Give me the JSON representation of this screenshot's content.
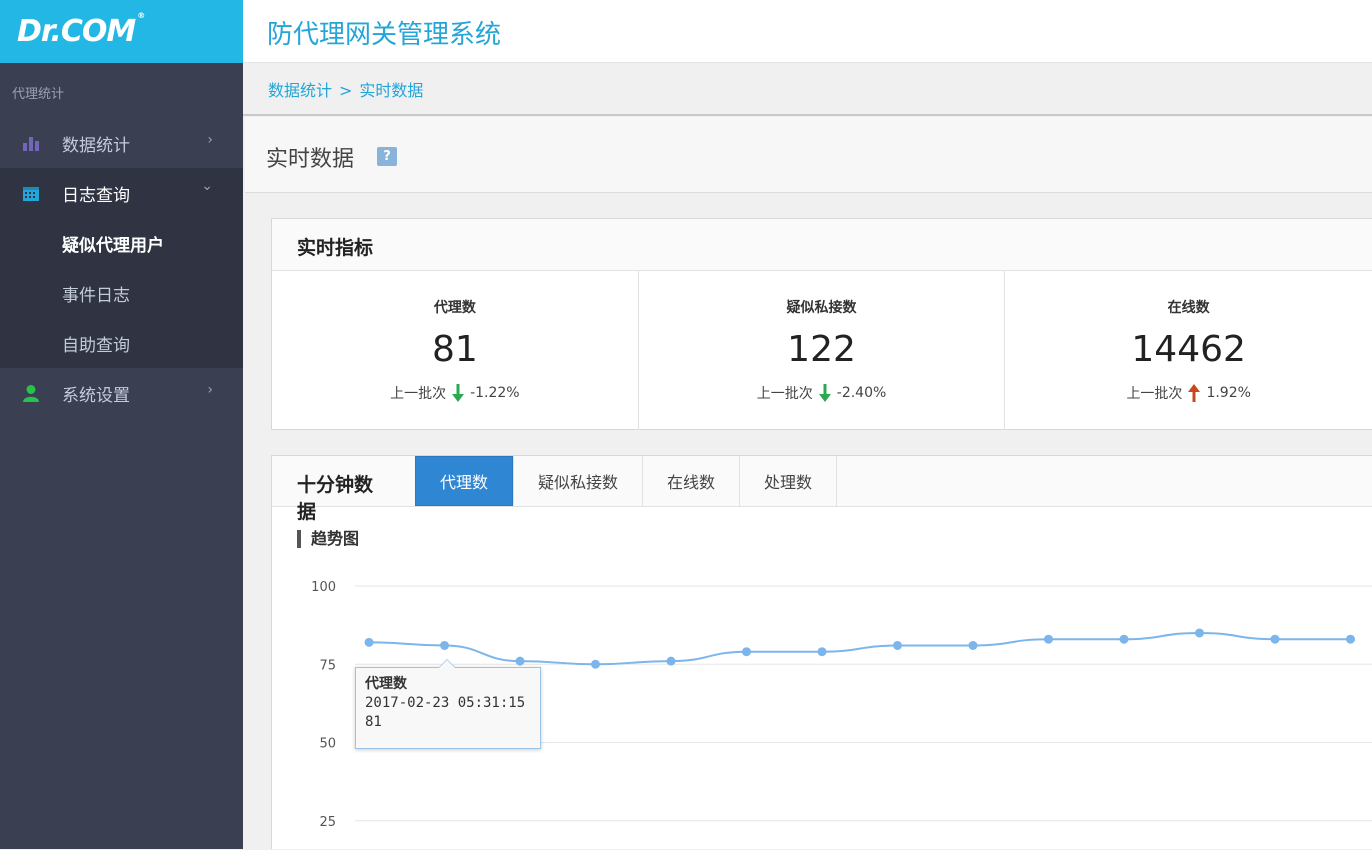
{
  "logo": {
    "text": "Dr.COM",
    "reg": "®"
  },
  "header": {
    "title": "防代理网关管理系统"
  },
  "sidebar": {
    "caption": "代理统计",
    "items": [
      {
        "label": "数据统计",
        "icon": "bar-chart-icon",
        "chevron": "›"
      },
      {
        "label": "日志查询",
        "icon": "calendar-icon",
        "chevron": "⌄"
      },
      {
        "label": "系统设置",
        "icon": "user-icon",
        "chevron": "›"
      }
    ],
    "subitems": [
      {
        "label": "疑似代理用户"
      },
      {
        "label": "事件日志"
      },
      {
        "label": "自助查询"
      }
    ]
  },
  "breadcrumb": {
    "root": "数据统计",
    "sep": ">",
    "current": "实时数据"
  },
  "page": {
    "title": "实时数据",
    "help": "?"
  },
  "realtime": {
    "title": "实时指标",
    "metrics": [
      {
        "label": "代理数",
        "value": "81",
        "prev_label": "上一批次",
        "change": "-1.22%",
        "direction": "down"
      },
      {
        "label": "疑似私接数",
        "value": "122",
        "prev_label": "上一批次",
        "change": "-2.40%",
        "direction": "down"
      },
      {
        "label": "在线数",
        "value": "14462",
        "prev_label": "上一批次",
        "change": "1.92%",
        "direction": "up"
      }
    ]
  },
  "tenmin": {
    "title": "十分钟数据",
    "tabs": [
      "代理数",
      "疑似私接数",
      "在线数",
      "处理数"
    ],
    "chart_title": "趋势图"
  },
  "tooltip": {
    "name": "代理数",
    "time": "2017-02-23 05:31:15",
    "value": "81"
  },
  "colors": {
    "accent": "#23b7e5",
    "line": "#7cb5ec",
    "down": "#2ea84f",
    "up": "#c8481e",
    "tab_active": "#2f86d3"
  },
  "chart_data": {
    "type": "line",
    "series": [
      {
        "name": "代理数",
        "values": [
          82,
          81,
          76,
          75,
          76,
          79,
          79,
          81,
          81,
          83,
          83,
          85,
          83,
          83
        ]
      }
    ],
    "ylim": [
      0,
      100
    ],
    "yticks": [
      25,
      50,
      75,
      100
    ],
    "grid": true
  }
}
